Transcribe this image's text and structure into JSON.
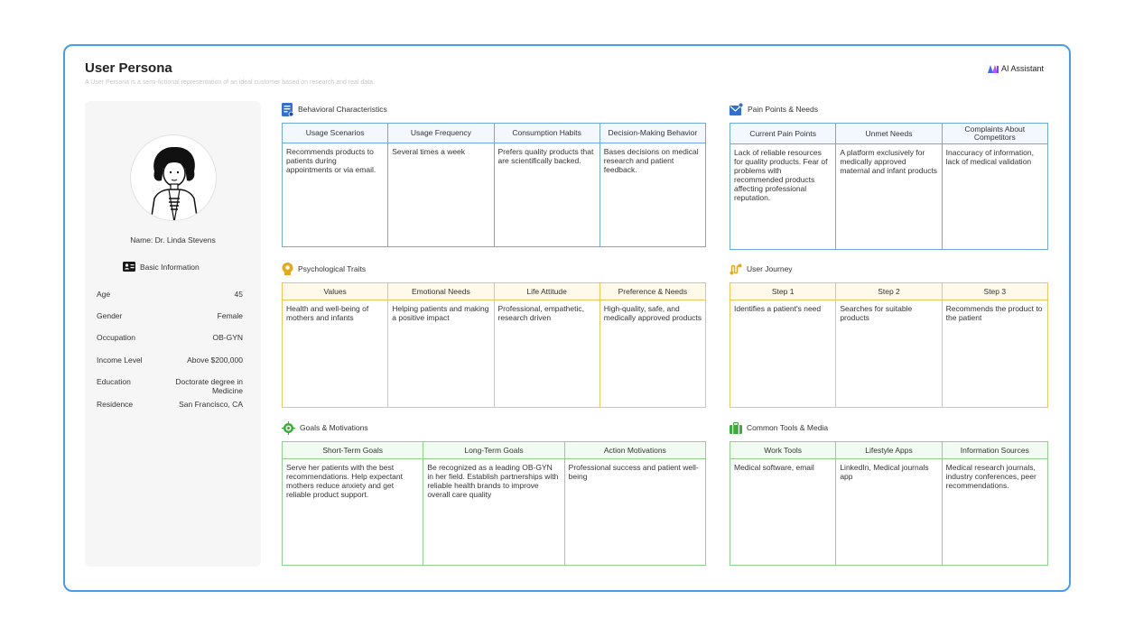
{
  "page": {
    "title": "User Persona",
    "subtitle": "A User Persona is a semi-fictional representation of an ideal customer based on research and real data.",
    "brand": "AI Assistant"
  },
  "profile": {
    "name": "Name: Dr. Linda Stevens",
    "basic_info_label": "Basic Information",
    "attributes": [
      {
        "label": "Age",
        "value": "45"
      },
      {
        "label": "Gender",
        "value": "Female"
      },
      {
        "label": "Occupation",
        "value": "OB-GYN"
      },
      {
        "label": "Income Level",
        "value": "Above $200,000"
      },
      {
        "label": "Education",
        "value": "Doctorate degree in Medicine"
      },
      {
        "label": "Residence",
        "value": "San Francisco, CA"
      }
    ]
  },
  "behavioral": {
    "title": "Behavioral Characteristics",
    "headers": [
      "Usage Scenarios",
      "Usage Frequency",
      "Consumption Habits",
      "Decision-Making Behavior"
    ],
    "cells": [
      "Recommends products to patients during appointments or via email.",
      "Several times a week",
      "Prefers quality products that are scientifically backed.",
      "Bases decisions on medical research and patient feedback."
    ]
  },
  "pain_points": {
    "title": "Pain Points & Needs",
    "headers": [
      "Current Pain Points",
      "Unmet Needs",
      "Complaints About Competitors"
    ],
    "cells": [
      "Lack of reliable resources for quality products. Fear of problems with recommended products affecting professional reputation.",
      "A platform exclusively for medically approved maternal and infant products",
      "Inaccuracy of information, lack of medical validation"
    ]
  },
  "psychological": {
    "title": "Psychological Traits",
    "headers": [
      "Values",
      "Emotional Needs",
      "Life Attitude",
      "Preference & Needs"
    ],
    "cells": [
      "Health and well-being of mothers and infants",
      "Helping patients and making a positive impact",
      "Professional, empathetic, research driven",
      "High-quality, safe, and medically approved products"
    ]
  },
  "journey": {
    "title": "User Journey",
    "headers": [
      "Step 1",
      "Step 2",
      "Step 3"
    ],
    "cells": [
      "Identifies a patient's need",
      "Searches for suitable products",
      "Recommends the product to the patient"
    ]
  },
  "goals": {
    "title": "Goals & Motivations",
    "headers": [
      "Short-Term Goals",
      "Long-Term Goals",
      "Action Motivations"
    ],
    "cells": [
      "Serve her patients with the best recommendations. Help expectant mothers reduce anxiety and get reliable product support.",
      "Be recognized as a leading OB-GYN in her field. Establish partnerships with reliable health brands to improve overall care quality",
      "Professional success and patient well-being"
    ]
  },
  "tools": {
    "title": "Common Tools & Media",
    "headers": [
      "Work Tools",
      "Lifestyle Apps",
      "Information Sources"
    ],
    "cells": [
      "Medical software, email",
      "LinkedIn, Medical journals app",
      "Medical research journals, industry conferences, peer recommendations."
    ]
  },
  "colors": {
    "frame": "#4a9be8",
    "blue": "#6fa8e6",
    "yellow": "#f3c45b",
    "green": "#8fd18d",
    "sidebar": "#f6f6f6"
  },
  "icons": {
    "brand": "ai-logo-icon",
    "basic_info": "id-card-icon",
    "behavioral": "document-icon",
    "pain_points": "mail-check-icon",
    "psychological": "lightbulb-head-icon",
    "journey": "route-icon",
    "goals": "target-icon",
    "tools": "toolbox-icon"
  }
}
